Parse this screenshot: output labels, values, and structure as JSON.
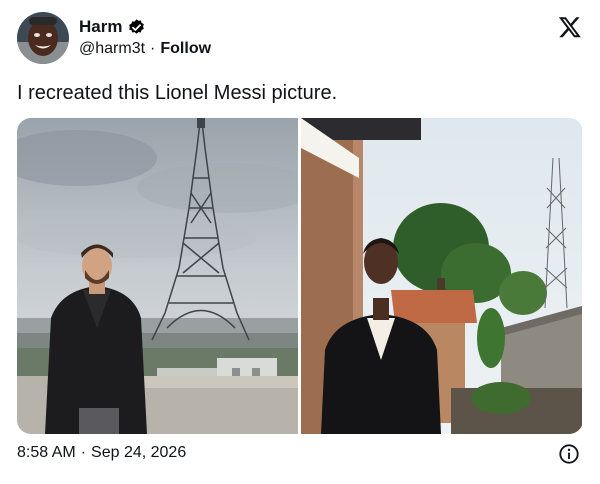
{
  "author": {
    "display_name": "Harm",
    "handle": "@harm3t",
    "separator": "·",
    "follow_label": "Follow",
    "verified": true,
    "verified_color": "#000000"
  },
  "brand": {
    "logo_icon": "x-logo-icon"
  },
  "tweet": {
    "text": "I recreated this Lionel Messi picture."
  },
  "media": {
    "count": 2
  },
  "footer": {
    "time": "8:58 AM",
    "separator": "·",
    "date": "Sep 24, 2026",
    "info_icon": "info-icon"
  }
}
